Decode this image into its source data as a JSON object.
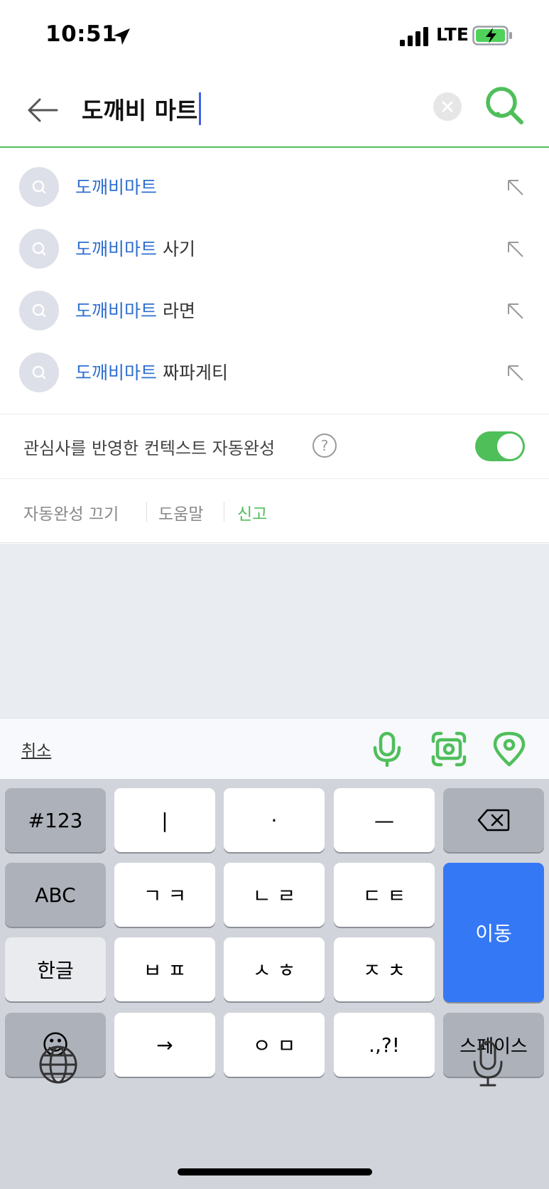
{
  "status_bar": {
    "time": "10:51",
    "network": "LTE"
  },
  "search": {
    "query": "도깨비 마트"
  },
  "suggestions": [
    {
      "highlight": "도깨비마트",
      "rest": ""
    },
    {
      "highlight": "도깨비마트",
      "rest": " 사기"
    },
    {
      "highlight": "도깨비마트",
      "rest": " 라면"
    },
    {
      "highlight": "도깨비마트",
      "rest": " 짜파게티"
    }
  ],
  "context_autocomplete": {
    "label": "관심사를 반영한 컨텍스트 자동완성",
    "help_glyph": "?",
    "enabled": true
  },
  "links": {
    "disable": "자동완성 끄기",
    "help": "도움말",
    "report": "신고"
  },
  "accessory": {
    "cancel": "취소"
  },
  "keyboard": {
    "row1": [
      "#123",
      "|",
      "·",
      "—"
    ],
    "row2": [
      "ABC",
      "ㄱ ㅋ",
      "ㄴ ㄹ",
      "ㄷ ㅌ"
    ],
    "row3": [
      "한글",
      "ㅂ ㅍ",
      "ㅅ ㅎ",
      "ㅈ ㅊ"
    ],
    "row4": [
      "☺",
      "→",
      "ㅇ ㅁ",
      ".,?!",
      "스페이스"
    ],
    "go": "이동"
  },
  "colors": {
    "accent_green": "#4fbf5a",
    "highlight_blue": "#2f6fcf",
    "key_blue": "#3478f6"
  }
}
